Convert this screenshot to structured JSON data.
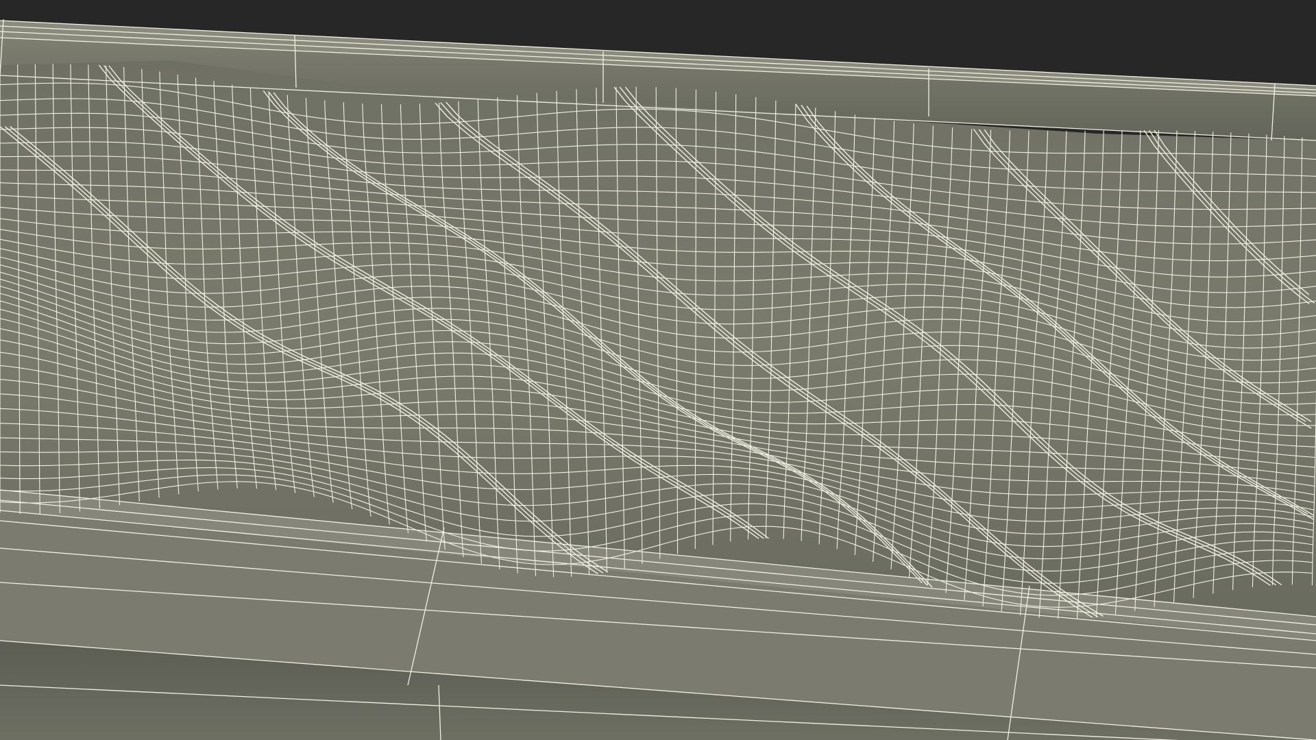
{
  "scene": {
    "subject": "wireframe-terrain-mesh",
    "render_mode": "wireframe-over-shaded",
    "colors": {
      "background": "#272727",
      "surface": "#77786a",
      "surface_dark": "#5e5f55",
      "surface_light": "#8a8b7d",
      "wire": "#f1f1e3"
    }
  }
}
